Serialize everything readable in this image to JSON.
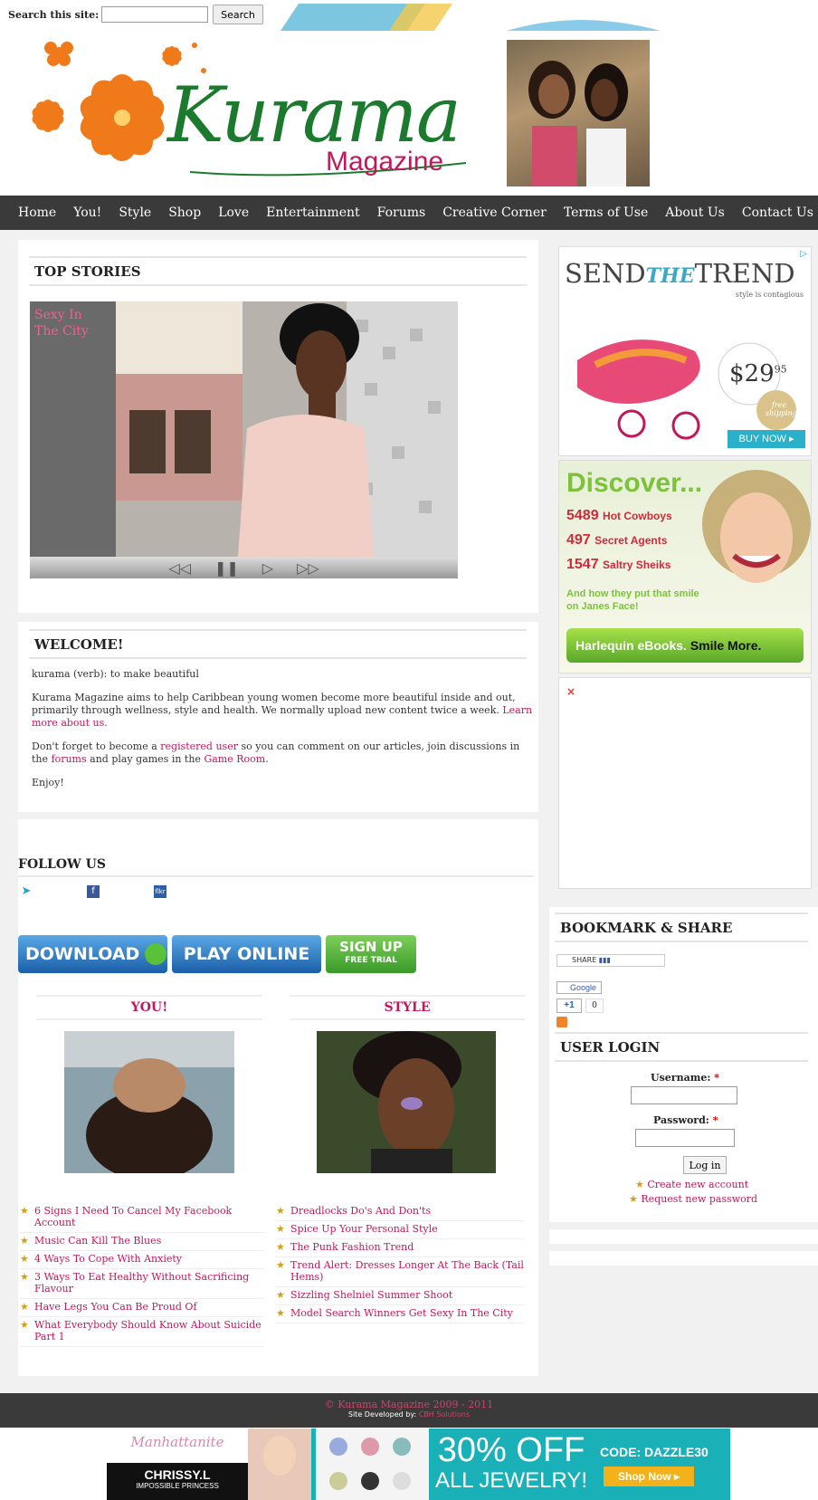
{
  "search": {
    "label": "Search this site:",
    "value": "",
    "button": "Search"
  },
  "site": {
    "logo_script": "Kurama",
    "logo_sub": "Magazine"
  },
  "nav": [
    "Home",
    "You!",
    "Style",
    "Shop",
    "Love",
    "Entertainment",
    "Forums",
    "Creative Corner",
    "Terms of Use",
    "About Us",
    "Contact Us"
  ],
  "top_stories": {
    "title": "TOP STORIES",
    "slide_caption": "Sexy In The City",
    "controls": [
      "◁◁",
      "❚❚",
      "▷",
      "▷▷"
    ]
  },
  "welcome": {
    "title": "WELCOME!",
    "p1": "kurama (verb): to make beautiful",
    "p2_text": "Kurama Magazine aims to help Caribbean young women become more beautiful inside and out, primarily through wellness, style and health. We normally upload new content twice a week. ",
    "p2_link": "Learn more about us.",
    "p3_a": "Don't forget to become a ",
    "p3_link1": "registered user",
    "p3_b": " so you can comment on our articles, join discussions in the ",
    "p3_link2": "forums",
    "p3_c": " and play games in the ",
    "p3_link3": "Game Room",
    "p3_d": ".",
    "p4": "Enjoy!"
  },
  "follow": {
    "title": "FOLLOW US",
    "icons": [
      "twitter-icon",
      "facebook-icon",
      "flickr-icon"
    ]
  },
  "game_ad": {
    "download": "DOWNLOAD",
    "play": "PLAY ONLINE",
    "signup": "SIGN UP",
    "signup_sub": "FREE TRIAL"
  },
  "columns": [
    {
      "title": "YOU!",
      "items": [
        "6 Signs I Need To Cancel My Facebook Account",
        "Music Can Kill The Blues",
        "4 Ways To Cope With Anxiety",
        "3 Ways To Eat Healthy Without Sacrificing Flavour",
        "Have Legs You Can Be Proud Of",
        "What Everybody Should Know About Suicide Part 1"
      ]
    },
    {
      "title": "STYLE",
      "items": [
        "Dreadlocks Do's And Don'ts",
        "Spice Up Your Personal Style",
        "The Punk Fashion Trend",
        "Trend Alert: Dresses Longer At The Back (Tail Hems)",
        "Sizzling Shelniel Summer Shoot",
        "Model Search Winners Get Sexy In The City"
      ]
    }
  ],
  "ads": {
    "trend": {
      "headline_a": "SEND",
      "headline_b": "THE",
      "headline_c": "TREND",
      "tag": "style is contagious",
      "price": "$29",
      "price_cents": "95",
      "badge": "free shipping",
      "cta": "BUY NOW ▸"
    },
    "harlequin": {
      "headline": "Discover...",
      "lines": [
        {
          "num": "5489",
          "text": "Hot Cowboys"
        },
        {
          "num": "497",
          "text": "Secret Agents"
        },
        {
          "num": "1547",
          "text": "Saltry Sheiks"
        }
      ],
      "tagline": "And how they put that smile on Janes Face!",
      "cta_a": "Harlequin eBooks.",
      "cta_b": "Smile More."
    }
  },
  "bookmark": {
    "title": "BOOKMARK & SHARE",
    "share": "SHARE",
    "google": "Google",
    "plus": "+1",
    "count": "0"
  },
  "login": {
    "title": "USER LOGIN",
    "username_label": "Username:",
    "password_label": "Password:",
    "required": "*",
    "button": "Log in",
    "create": "Create new account",
    "request": "Request new password"
  },
  "footer": {
    "copyright": "© Kurama Magazine 2009 - 2011",
    "dev_label": "Site Developed by:",
    "dev_name": "CBH Solutions"
  },
  "bottom_ad": {
    "brand_script": "Manhattanite",
    "brand": "CHRISSY.L",
    "brand_sub": "IMPOSSIBLE PRINCESS",
    "offer1": "30% OFF",
    "offer2": "ALL JEWELRY!",
    "code": "CODE: DAZZLE30",
    "cta": "Shop Now ▸"
  },
  "colors": {
    "nav_bg": "#3a3a3a",
    "link": "#c2185b",
    "logo_green": "#1b7a2e",
    "logo_orange": "#f07a1a",
    "magenta": "#c2185b"
  }
}
